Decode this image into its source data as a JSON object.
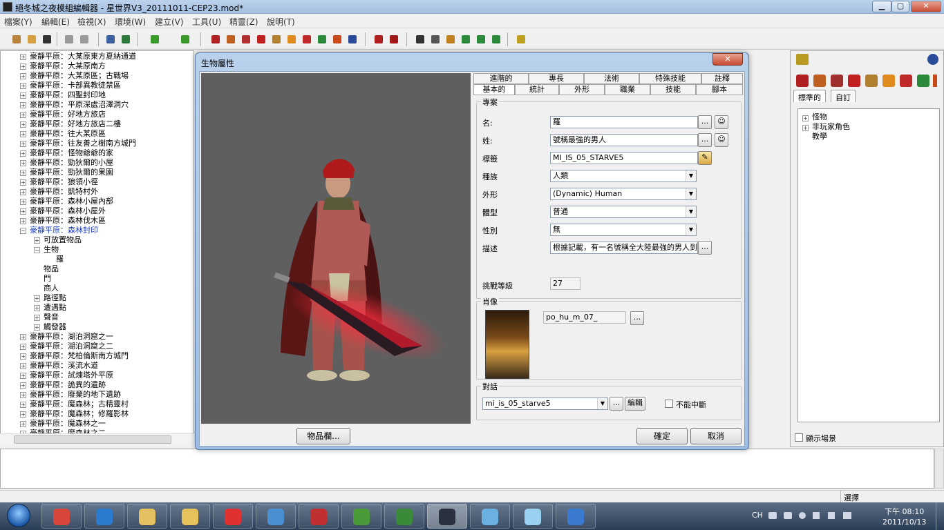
{
  "window": {
    "title": "絕冬城之夜模組編輯器 - 星世界V3_20111011-CEP23.mod*",
    "min": "▁",
    "max": "▢",
    "close": "✕"
  },
  "menu": [
    "檔案(Y)",
    "編輯(E)",
    "檢視(X)",
    "環境(W)",
    "建立(V)",
    "工具(U)",
    "精靈(Z)",
    "說明(T)"
  ],
  "toolbar_icons": [
    {
      "name": "wand-icon",
      "color": "#b8823a"
    },
    {
      "name": "open-icon",
      "color": "#d6a040"
    },
    {
      "name": "save-icon",
      "color": "#333333"
    },
    {
      "name": "undo-icon",
      "color": "#9a9a9a"
    },
    {
      "name": "redo-icon",
      "color": "#9a9a9a"
    },
    {
      "name": "area-icon",
      "color": "#3a5f9e"
    },
    {
      "name": "paint-icon",
      "color": "#2d7a3a"
    },
    {
      "name": "arrow-left-icon",
      "color": "#3a9a2a"
    },
    {
      "name": "arrow-right-icon",
      "color": "#3a9a2a"
    },
    {
      "name": "creature-icon",
      "color": "#b02020"
    },
    {
      "name": "door-icon",
      "color": "#c06020"
    },
    {
      "name": "trap-icon",
      "color": "#b03030"
    },
    {
      "name": "encounter-icon",
      "color": "#c02020"
    },
    {
      "name": "placeable-icon",
      "color": "#b08030"
    },
    {
      "name": "item-icon",
      "color": "#e08a20"
    },
    {
      "name": "trigger-icon",
      "color": "#c02a2a"
    },
    {
      "name": "waypoint-icon",
      "color": "#2a8a3a"
    },
    {
      "name": "sound-icon",
      "color": "#c84a1a"
    },
    {
      "name": "store-icon",
      "color": "#2a4a9a"
    },
    {
      "name": "conversation-icon",
      "color": "#b02020"
    },
    {
      "name": "lips-icon",
      "color": "#a01818"
    },
    {
      "name": "brush-icon",
      "color": "#333333"
    },
    {
      "name": "pencil-icon",
      "color": "#555555"
    },
    {
      "name": "potion-icon",
      "color": "#c08020"
    },
    {
      "name": "script-icon",
      "color": "#2a8a3a"
    },
    {
      "name": "compile-icon",
      "color": "#2a8a3a"
    },
    {
      "name": "build-icon",
      "color": "#2a8a3a"
    },
    {
      "name": "key-icon",
      "color": "#c0a020"
    }
  ],
  "tree": {
    "items": [
      "豪靜平原：大某原東方夏納通道",
      "豪靜平原：大某原南方",
      "豪靜平原：大某原區；古戰場",
      "豪靜平原：卡部異教徒禁區",
      "豪靜平原：四聖封印地",
      "豪靜平原：平原深處沼澤洞穴",
      "豪靜平原：好地方旅店",
      "豪靜平原：好地方旅店二樓",
      "豪靜平原：往大某原區",
      "豪靜平原：往友善之樹南方城門",
      "豪靜平原：怪物爺爺的家",
      "豪靜平原：勁狄爾的小屋",
      "豪靜平原：勁狄爾的果園",
      "豪靜平原：狼領小徑",
      "豪靜平原：凱特村外",
      "豪靜平原：森林小屋內部",
      "豪靜平原：森林小屋外",
      "豪靜平原：森林伐木區",
      "豪靜平原：森林封印"
    ],
    "children": [
      "可放置物品",
      "生物",
      "羅",
      "物品",
      "門",
      "商人",
      "路徑點",
      "遭遇點",
      "聲音",
      "觸發器"
    ],
    "items_after": [
      "豪靜平原：湖泊洞窟之一",
      "豪靜平原：湖泊洞窟之二",
      "豪靜平原：梵柏倫斯南方城門",
      "豪靜平原：溪流水道",
      "豪靜平原：試煉塔外平原",
      "豪靜平原：詭異的遺跡",
      "豪靜平原：廢棄的地下遺跡",
      "豪靜平原：魔森林；古精靈村",
      "豪靜平原：魔森林；修羅影林",
      "豪靜平原：魔森林之一",
      "豪靜平原：魔森林之二"
    ]
  },
  "dialog": {
    "title": "生物屬性",
    "close": "✕",
    "tabs_top": [
      "進階的",
      "專長",
      "法術",
      "特殊技能",
      "註釋"
    ],
    "tabs_bottom": [
      "基本的",
      "統計",
      "外形",
      "職業",
      "技能",
      "腳本"
    ],
    "profile": {
      "group": "專案",
      "name_label": "名:",
      "name_value": "羅",
      "surname_label": "姓:",
      "surname_value": "號稱最強的男人",
      "tag_label": "標籤",
      "tag_value": "MI_IS_05_STARVE5",
      "race_label": "種族",
      "race_value": "人類",
      "appearance_label": "外形",
      "appearance_value": "(Dynamic) Human",
      "phenotype_label": "體型",
      "phenotype_value": "普通",
      "gender_label": "性別",
      "gender_value": "無",
      "description_label": "描述",
      "description_value": "根據記載，有一名號稱全大陸最強的男人到",
      "cr_label": "挑戰等級",
      "cr_value": "27",
      "ellipsis": "..."
    },
    "portrait": {
      "group": "肖像",
      "value": "po_hu_m_07_",
      "ellipsis": "..."
    },
    "conversation": {
      "group": "對話",
      "value": "mi_is_05_starve5",
      "ellipsis": "...",
      "edit": "編輯",
      "no_interrupt": "不能中斷"
    },
    "inventory_button": "物品欄...",
    "ok": "確定",
    "cancel": "取消"
  },
  "right_panel": {
    "tabs": [
      "標準的",
      "自訂"
    ],
    "tree": [
      "怪物",
      "非玩家角色",
      "教學"
    ],
    "show_scene": "顯示場景"
  },
  "status": {
    "right_text": "選擇"
  },
  "taskbar": {
    "apps": [
      {
        "name": "chrome",
        "color": "#d8453a"
      },
      {
        "name": "ie",
        "color": "#2a7ad0"
      },
      {
        "name": "notes",
        "color": "#e4c060"
      },
      {
        "name": "explorer",
        "color": "#e6c25a"
      },
      {
        "name": "arrow-app",
        "color": "#e03030"
      },
      {
        "name": "picasa",
        "color": "#4a90d0"
      },
      {
        "name": "autodesk",
        "color": "#c03030"
      },
      {
        "name": "evernote",
        "color": "#4a9a3a"
      },
      {
        "name": "evernote2",
        "color": "#3a8a3a"
      },
      {
        "name": "nwn-toolset",
        "color": "#2a3040"
      },
      {
        "name": "messenger",
        "color": "#6ab0e0"
      },
      {
        "name": "notepad",
        "color": "#9ad0f0"
      },
      {
        "name": "itunes",
        "color": "#3a7ad0"
      }
    ],
    "lang": "CH",
    "time": "下午 08:10",
    "date": "2011/10/13"
  }
}
